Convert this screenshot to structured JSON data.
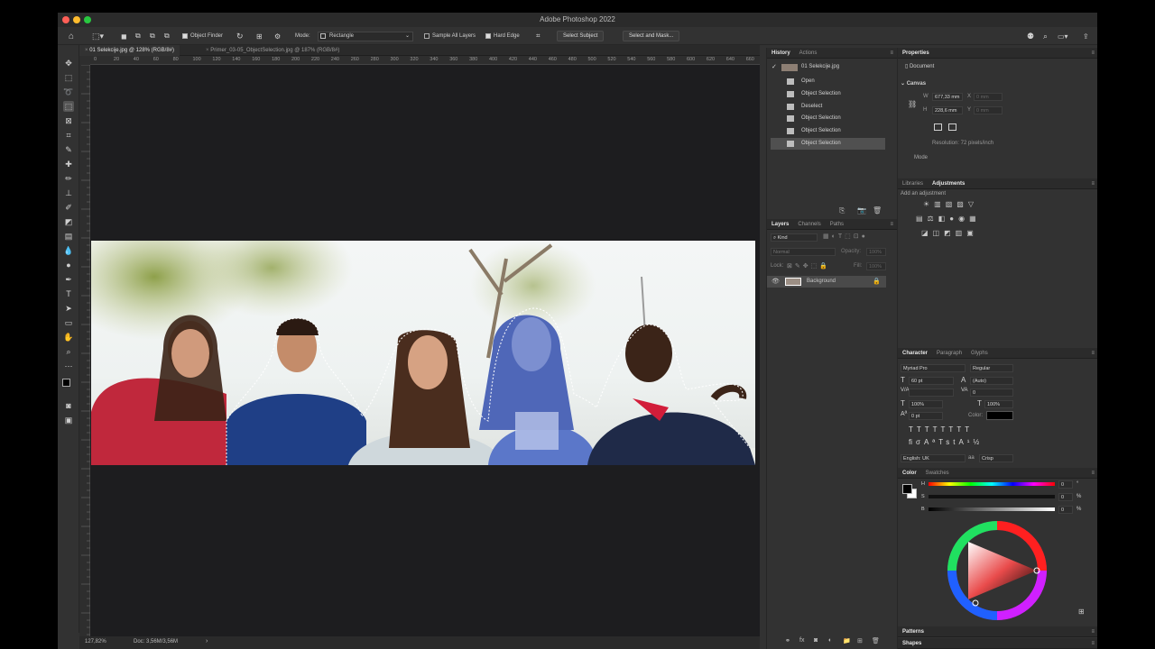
{
  "app": {
    "title": "Adobe Photoshop 2022"
  },
  "options_bar": {
    "object_finder": "Object Finder",
    "mode_label": "Mode:",
    "mode_value": "Rectangle",
    "sample_all_layers": "Sample All Layers",
    "hard_edge": "Hard Edge",
    "select_subject": "Select Subject",
    "select_and_mask": "Select and Mask..."
  },
  "doc_tabs": [
    {
      "label": "01 Selekcije.jpg @ 128% (RGB/8#)",
      "active": true
    },
    {
      "label": "Primer_03-05_ObjectSelection.jpg @ 187% (RGB/8#)",
      "active": false
    }
  ],
  "ruler_ticks": [
    "0",
    "20",
    "40",
    "60",
    "80",
    "100",
    "120",
    "140",
    "160",
    "180",
    "200",
    "220",
    "240",
    "260",
    "280",
    "300",
    "320",
    "340",
    "360",
    "380",
    "400",
    "420",
    "440",
    "460",
    "480",
    "500",
    "520",
    "540",
    "560",
    "580",
    "600",
    "620",
    "640",
    "660"
  ],
  "status": {
    "zoom": "127,82%",
    "doc": "Doc: 3,56M/3,56M"
  },
  "history": {
    "tabs": [
      "History",
      "Actions"
    ],
    "snapshot": "01 Selekcije.jpg",
    "items": [
      "Open",
      "Object Selection",
      "Deselect",
      "Object Selection",
      "Object Selection",
      "Object Selection"
    ]
  },
  "properties": {
    "title": "Properties",
    "document": "Document",
    "canvas": "Canvas",
    "w_label": "W",
    "w_value": "677,33 mm",
    "h_label": "H",
    "h_value": "228,6 mm",
    "x_label": "X",
    "y_label": "Y",
    "x_value": "0 mm",
    "y_value": "0 mm",
    "resolution": "Resolution: 72 pixels/inch",
    "mode": "Mode"
  },
  "adjustments": {
    "tabs": [
      "Libraries",
      "Adjustments"
    ],
    "add": "Add an adjustment"
  },
  "layers": {
    "tabs": [
      "Layers",
      "Channels",
      "Paths"
    ],
    "kind": "Kind",
    "blend": "Normal",
    "opacity_label": "Opacity:",
    "opacity_value": "100%",
    "lock_label": "Lock:",
    "fill_label": "Fill:",
    "fill_value": "100%",
    "layer_name": "Background"
  },
  "character": {
    "tabs": [
      "Character",
      "Paragraph",
      "Glyphs"
    ],
    "font": "Myriad Pro",
    "style": "Regular",
    "size": "60 pt",
    "leading": "(Auto)",
    "tracking": "0",
    "vscale": "100%",
    "hscale": "100%",
    "baseline": "0 pt",
    "color_label": "Color:",
    "language": "English: UK",
    "aa_label": "aa",
    "aa": "Crisp"
  },
  "color": {
    "tabs": [
      "Color",
      "Swatches"
    ],
    "h_label": "H",
    "s_label": "S",
    "b_label": "B",
    "h": "0",
    "s": "0",
    "b": "0",
    "h_unit": "°",
    "s_unit": "%",
    "b_unit": "%"
  },
  "bottom_panels": {
    "patterns": "Patterns",
    "shapes": "Shapes"
  }
}
